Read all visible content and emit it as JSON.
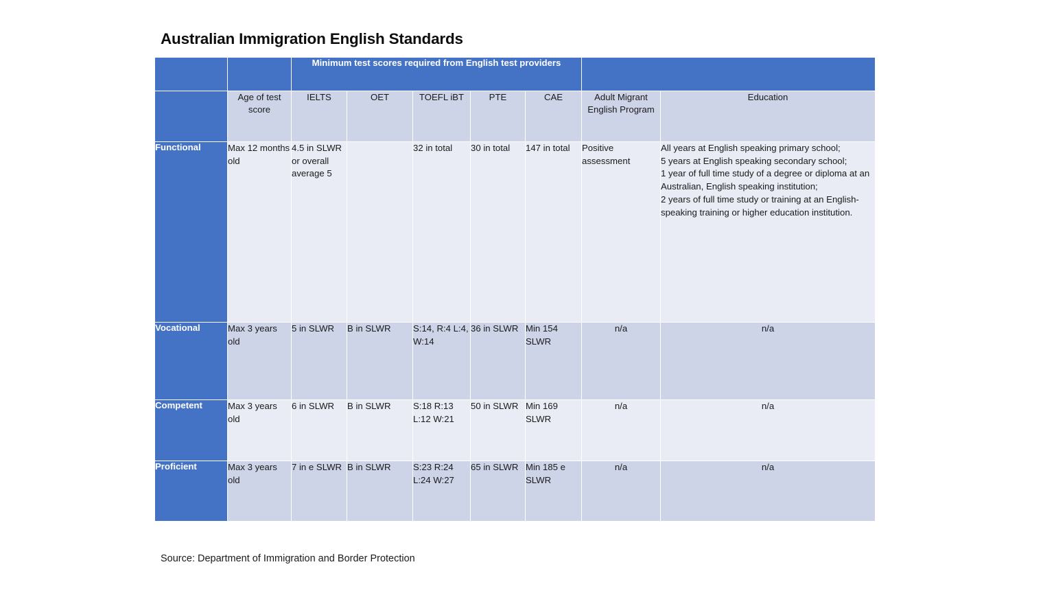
{
  "page": {
    "title": "Australian Immigration English Standards",
    "source_note": "Source: Department of Immigration and Border Protection"
  },
  "theme": {
    "header_blue": "#4472C4",
    "row_light": "#E9ECF5",
    "row_dark": "#CED4E8",
    "header_text": "#FFFFFF",
    "body_text": "#1A1A1A",
    "grid_line": "#FFFFFF"
  },
  "table": {
    "group_header": {
      "corner": "",
      "age_spacer": "",
      "test_providers_label": "Minimum test scores required from English test providers",
      "right_spacer": ""
    },
    "columns": [
      {
        "key": "level",
        "label": ""
      },
      {
        "key": "age",
        "label": "Age of test score"
      },
      {
        "key": "ielts",
        "label": "IELTS"
      },
      {
        "key": "oet",
        "label": "OET"
      },
      {
        "key": "toefl",
        "label": "TOEFL iBT"
      },
      {
        "key": "pte",
        "label": "PTE"
      },
      {
        "key": "cae",
        "label": "CAE"
      },
      {
        "key": "amep",
        "label": "Adult Migrant English Program"
      },
      {
        "key": "education",
        "label": "Education"
      }
    ],
    "rows": [
      {
        "level": "Functional",
        "band": "light",
        "age": "Max 12 months old",
        "ielts": "4.5 in SLWR or overall average 5",
        "oet": "",
        "toefl": "32 in total",
        "pte": "30 in total",
        "cae": "147 in total",
        "amep": "Positive assessment",
        "education_lines": [
          "All years at English speaking primary school;",
          "5 years at English speaking secondary school;",
          "1 year of full time study of a degree or diploma at an Australian, English speaking institution;",
          "2 years of full time study or training at an English-speaking training or higher education institution."
        ]
      },
      {
        "level": "Vocational",
        "band": "dark",
        "age": "Max 3 years old",
        "ielts": "5 in SLWR",
        "oet": "B in SLWR",
        "toefl": "S:14, R:4 L:4, W:14",
        "pte": "36 in SLWR",
        "cae": "Min 154 SLWR",
        "amep": "n/a",
        "education": "n/a"
      },
      {
        "level": "Competent",
        "band": "light",
        "age": "Max 3 years old",
        "ielts": "6 in SLWR",
        "oet": "B in SLWR",
        "toefl": "S:18 R:13 L:12 W:21",
        "pte": "50 in SLWR",
        "cae": "Min 169 SLWR",
        "amep": "n/a",
        "education": "n/a"
      },
      {
        "level": "Proficient",
        "band": "dark",
        "age": "Max 3 years old",
        "ielts": "7 in e SLWR",
        "oet": "B in SLWR",
        "toefl": "S:23 R:24 L:24 W:27",
        "pte": "65 in SLWR",
        "cae": "Min 185 e SLWR",
        "amep": "n/a",
        "education": "n/a"
      }
    ]
  }
}
